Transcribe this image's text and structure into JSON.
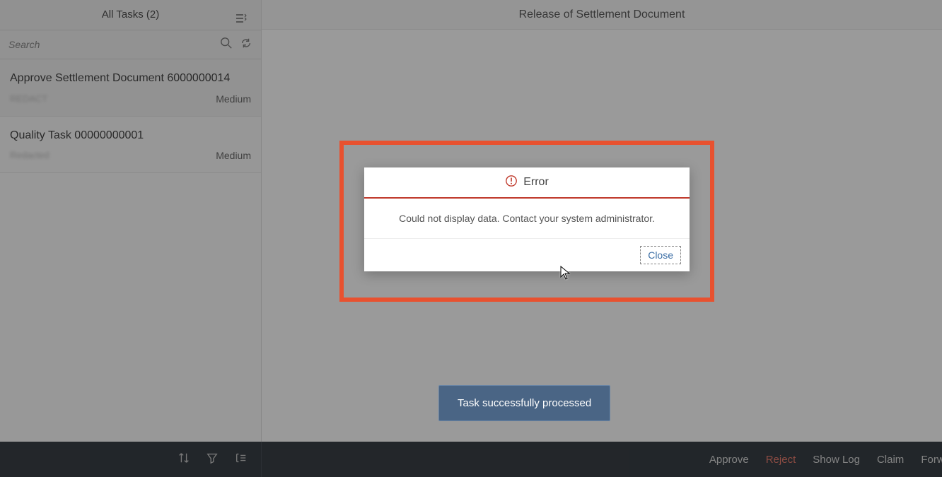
{
  "panel": {
    "title_prefix": "All Tasks",
    "count": "(2)",
    "search_placeholder": "Search"
  },
  "tasks": [
    {
      "title": "Approve Settlement Document 6000000014",
      "sub": "REDACT",
      "priority": "Medium"
    },
    {
      "title": "Quality Task 00000000001",
      "sub": "Redacted",
      "priority": "Medium"
    }
  ],
  "detail": {
    "header": "Release of Settlement Document"
  },
  "dialog": {
    "title": "Error",
    "message": "Could not display data. Contact your system administrator.",
    "close_label": "Close"
  },
  "toast": {
    "text": "Task successfully processed"
  },
  "footer": {
    "approve": "Approve",
    "reject": "Reject",
    "showlog": "Show Log",
    "claim": "Claim",
    "forward": "Forwa"
  }
}
